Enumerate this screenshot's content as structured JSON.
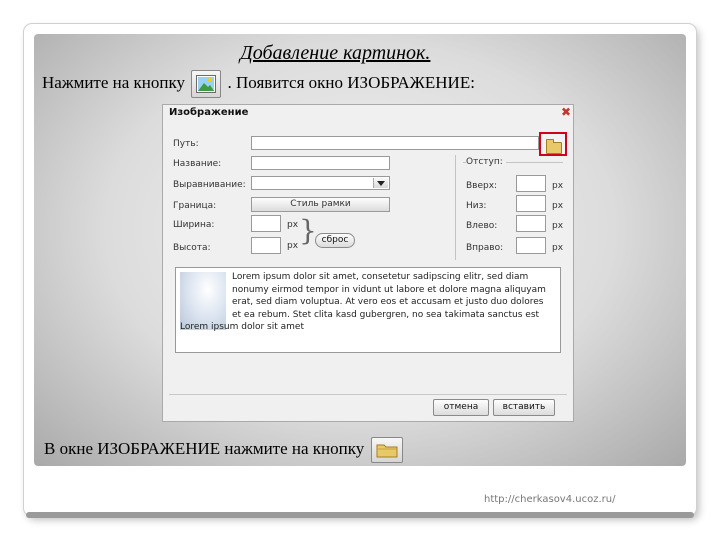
{
  "slide": {
    "title": "Добавление картинок.",
    "instruction_before": "Нажмите на кнопку",
    "instruction_after": ". Появится окно ИЗОБРАЖЕНИЕ:",
    "bottom_text": "В окне ИЗОБРАЖЕНИЕ нажмите на кнопку",
    "url": "http://cherkasov4.ucoz.ru/"
  },
  "dialog": {
    "title": "Изображение",
    "close": "✖",
    "labels": {
      "path": "Путь:",
      "name": "Название:",
      "align": "Выравнивание:",
      "border": "Граница:",
      "width": "Ширина:",
      "height": "Высота:",
      "indent": "Отступ:",
      "top": "Вверх:",
      "bottom": "Низ:",
      "left": "Влево:",
      "right": "Вправо:"
    },
    "unit": "px",
    "border_style_button": "Стиль рамки",
    "reset_button": "сброс",
    "preview_lines": [
      "Lorem ipsum dolor sit amet, consetetur sadipscing elitr, sed diam",
      "nonumy eirmod tempor in vidunt ut labore et dolore magna aliquyam",
      "erat, sed diam voluptua. At vero eos et accusam et justo duo dolores",
      "et ea rebum. Stet clita kasd gubergren, no sea takimata sanctus est",
      "Lorem ipsum dolor sit amet"
    ],
    "cancel_button": "отмена",
    "insert_button": "вставить"
  },
  "colors": {
    "highlight": "#d0021b",
    "folder": "#e8c96a"
  }
}
